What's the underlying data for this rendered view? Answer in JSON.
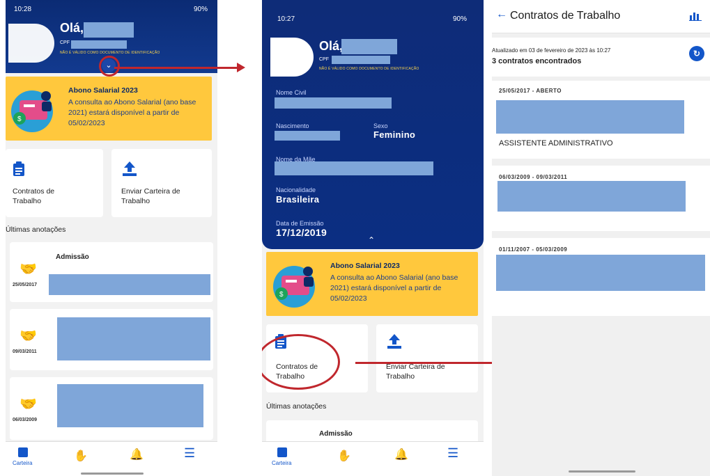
{
  "screen1": {
    "status_time": "10:28",
    "status_right": "90%",
    "greeting": "Olá,",
    "cpf_label": "CPF",
    "id_notice": "NÃO É VÁLIDO COMO DOCUMENTO DE IDENTIFICAÇÃO",
    "banner_title": "Abono Salarial 2023",
    "banner_text": "A consulta ao Abono Salarial (ano base 2021) estará disponível a partir de 05/02/2023",
    "card_contracts": "Contratos de Trabalho",
    "card_send": "Enviar Carteira de Trabalho",
    "section_label": "Últimas anotações",
    "notes": [
      {
        "title": "Admissão",
        "date": "25/05/2017"
      },
      {
        "title": "",
        "date": "09/03/2011"
      },
      {
        "title": "",
        "date": "06/03/2009"
      }
    ],
    "nav_carteira": "Carteira"
  },
  "screen2": {
    "status_time": "10:27",
    "status_right": "90%",
    "greeting": "Olá,",
    "cpf_label": "CPF",
    "id_notice": "NÃO É VÁLIDO COMO DOCUMENTO DE IDENTIFICAÇÃO",
    "nome_civil_label": "Nome Civil",
    "nascimento_label": "Nascimento",
    "sexo_label": "Sexo",
    "sexo_value": "Feminino",
    "nome_mae_label": "Nome da Mãe",
    "nacionalidade_label": "Nacionalidade",
    "nacionalidade_value": "Brasileira",
    "emissao_label": "Data de Emissão",
    "emissao_value": "17/12/2019",
    "banner_title": "Abono Salarial 2023",
    "banner_text": "A consulta ao Abono Salarial (ano base 2021) estará disponível a partir de 05/02/2023",
    "card_contracts": "Contratos de Trabalho",
    "card_send": "Enviar Carteira de Trabalho",
    "section_label": "Últimas anotações",
    "note_title": "Admissão",
    "nav_carteira": "Carteira"
  },
  "screen3": {
    "title": "Contratos de Trabalho",
    "updated": "Atualizado em 03 de fevereiro de 2023 às 10:27",
    "count": "3 contratos encontrados",
    "contracts": [
      {
        "period": "25/05/2017 - ABERTO",
        "role": "ASSISTENTE ADMINISTRATIVO"
      },
      {
        "period": "06/03/2009 - 09/03/2011",
        "role": ""
      },
      {
        "period": "01/11/2007 - 05/03/2009",
        "role": ""
      }
    ]
  },
  "colors": {
    "header_blue": "#0b2b74",
    "banner_yellow": "#ffc83d",
    "accent_blue": "#1356c9",
    "annotation_red": "#c0272d",
    "redaction": "#7fa6d9"
  }
}
